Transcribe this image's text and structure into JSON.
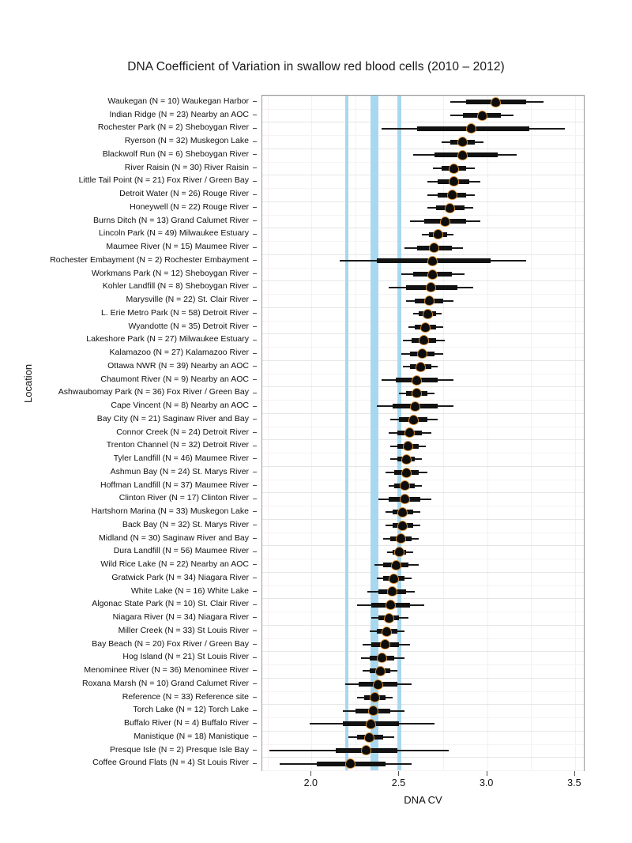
{
  "chart_data": {
    "type": "scatter",
    "title": "DNA Coefficient of Variation in swallow red blood cells (2010 – 2012)",
    "xlabel": "DNA CV",
    "ylabel": "Location",
    "xlim": [
      1.72,
      3.55
    ],
    "xticks": [
      2.0,
      2.5,
      3.0,
      3.5
    ],
    "xticklabels": [
      "2.0",
      "2.5",
      "3.0",
      "3.5"
    ],
    "grid": true,
    "legend": "none",
    "orientation": "horizontal",
    "series_description": "Point estimate with thick inner interval and thin outer interval per location",
    "reference_bands": [
      {
        "name": "ref-band-1",
        "value": 2.2,
        "color": "#a8d8ef"
      },
      {
        "name": "ref-band-2",
        "value": 2.36,
        "color": "#a8d8ef"
      },
      {
        "name": "ref-band-3",
        "value": 2.5,
        "color": "#a8d8ef"
      }
    ],
    "categories": [
      "Waukegan (N = 10) Waukegan Harbor",
      "Indian Ridge (N = 23) Nearby an AOC",
      "Rochester Park (N = 2) Sheboygan River",
      "Ryerson (N = 32) Muskegon Lake",
      "Blackwolf Run (N = 6) Sheboygan River",
      "River Raisin (N = 30) River Raisin",
      "Little Tail Point (N = 21) Fox River / Green Bay",
      "Detroit Water (N = 26) Rouge River",
      "Honeywell (N = 22) Rouge River",
      "Burns Ditch (N = 13) Grand Calumet River",
      "Lincoln Park (N = 49) Milwaukee Estuary",
      "Maumee River (N = 15) Maumee River",
      "Rochester Embayment (N = 2) Rochester Embayment",
      "Workmans Park (N = 12) Sheboygan River",
      "Kohler Landfill (N = 8) Sheboygan River",
      "Marysville (N = 22) St. Clair River",
      "L. Erie Metro Park (N = 58) Detroit River",
      "Wyandotte (N = 35) Detroit River",
      "Lakeshore Park (N = 27) Milwaukee Estuary",
      "Kalamazoo (N = 27) Kalamazoo River",
      "Ottawa NWR (N = 39) Nearby an AOC",
      "Chaumont River (N = 9) Nearby an AOC",
      "Ashwaubomay Park (N = 36) Fox River / Green Bay",
      "Cape Vincent (N = 8) Nearby an AOC",
      "Bay City (N = 21) Saginaw River and Bay",
      "Connor Creek (N = 24) Detroit River",
      "Trenton Channel (N = 32) Detroit River",
      "Tyler Landfill (N = 46) Maumee River",
      "Ashmun Bay (N = 24) St. Marys River",
      "Hoffman Landfill (N = 37) Maumee River",
      "Clinton River (N = 17) Clinton River",
      "Hartshorn Marina (N = 33) Muskegon Lake",
      "Back Bay (N = 32) St. Marys River",
      "Midland (N = 30) Saginaw River and Bay",
      "Dura Landfill (N = 56) Maumee River",
      "Wild Rice Lake (N = 22) Nearby an AOC",
      "Gratwick Park (N = 34) Niagara River",
      "White Lake (N = 16) White Lake",
      "Algonac State Park (N = 10) St. Clair River",
      "Niagara River (N = 34) Niagara River",
      "Miller Creek (N = 33) St Louis River",
      "Bay Beach (N = 20) Fox River / Green Bay",
      "Hog Island (N = 21) St Louis River",
      "Menominee River (N = 36) Menominee River",
      "Roxana Marsh (N = 10) Grand Calumet River",
      "Reference (N = 33) Reference site",
      "Torch Lake (N = 12) Torch Lake",
      "Buffalo River (N = 4) Buffalo River",
      "Manistique (N = 18) Manistique",
      "Presque Isle (N = 2) Presque Isle Bay",
      "Coffee Ground Flats (N = 4) St Louis River"
    ],
    "points": [
      {
        "value": 3.05,
        "inner_low": 2.88,
        "inner_high": 3.22,
        "outer_low": 2.79,
        "outer_high": 3.32
      },
      {
        "value": 2.97,
        "inner_low": 2.86,
        "inner_high": 3.08,
        "outer_low": 2.79,
        "outer_high": 3.15
      },
      {
        "value": 2.91,
        "inner_low": 2.6,
        "inner_high": 3.24,
        "outer_low": 2.4,
        "outer_high": 3.44
      },
      {
        "value": 2.86,
        "inner_low": 2.79,
        "inner_high": 2.93,
        "outer_low": 2.74,
        "outer_high": 2.98
      },
      {
        "value": 2.86,
        "inner_low": 2.7,
        "inner_high": 3.06,
        "outer_low": 2.58,
        "outer_high": 3.17
      },
      {
        "value": 2.81,
        "inner_low": 2.74,
        "inner_high": 2.88,
        "outer_low": 2.69,
        "outer_high": 2.93
      },
      {
        "value": 2.81,
        "inner_low": 2.72,
        "inner_high": 2.9,
        "outer_low": 2.66,
        "outer_high": 2.96
      },
      {
        "value": 2.8,
        "inner_low": 2.72,
        "inner_high": 2.88,
        "outer_low": 2.66,
        "outer_high": 2.93
      },
      {
        "value": 2.79,
        "inner_low": 2.71,
        "inner_high": 2.87,
        "outer_low": 2.66,
        "outer_high": 2.92
      },
      {
        "value": 2.76,
        "inner_low": 2.64,
        "inner_high": 2.88,
        "outer_low": 2.56,
        "outer_high": 2.96
      },
      {
        "value": 2.72,
        "inner_low": 2.67,
        "inner_high": 2.77,
        "outer_low": 2.63,
        "outer_high": 2.81
      },
      {
        "value": 2.7,
        "inner_low": 2.6,
        "inner_high": 2.8,
        "outer_low": 2.53,
        "outer_high": 2.86
      },
      {
        "value": 2.69,
        "inner_low": 2.37,
        "inner_high": 3.02,
        "outer_low": 2.16,
        "outer_high": 3.22
      },
      {
        "value": 2.69,
        "inner_low": 2.58,
        "inner_high": 2.8,
        "outer_low": 2.51,
        "outer_high": 2.87
      },
      {
        "value": 2.68,
        "inner_low": 2.54,
        "inner_high": 2.83,
        "outer_low": 2.44,
        "outer_high": 2.92
      },
      {
        "value": 2.67,
        "inner_low": 2.59,
        "inner_high": 2.75,
        "outer_low": 2.54,
        "outer_high": 2.81
      },
      {
        "value": 2.66,
        "inner_low": 2.61,
        "inner_high": 2.71,
        "outer_low": 2.58,
        "outer_high": 2.74
      },
      {
        "value": 2.65,
        "inner_low": 2.59,
        "inner_high": 2.71,
        "outer_low": 2.55,
        "outer_high": 2.75
      },
      {
        "value": 2.64,
        "inner_low": 2.57,
        "inner_high": 2.71,
        "outer_low": 2.52,
        "outer_high": 2.76
      },
      {
        "value": 2.63,
        "inner_low": 2.56,
        "inner_high": 2.7,
        "outer_low": 2.51,
        "outer_high": 2.75
      },
      {
        "value": 2.62,
        "inner_low": 2.56,
        "inner_high": 2.68,
        "outer_low": 2.52,
        "outer_high": 2.72
      },
      {
        "value": 2.6,
        "inner_low": 2.48,
        "inner_high": 2.72,
        "outer_low": 2.4,
        "outer_high": 2.81
      },
      {
        "value": 2.6,
        "inner_low": 2.54,
        "inner_high": 2.66,
        "outer_low": 2.5,
        "outer_high": 2.7
      },
      {
        "value": 2.59,
        "inner_low": 2.46,
        "inner_high": 2.72,
        "outer_low": 2.37,
        "outer_high": 2.81
      },
      {
        "value": 2.58,
        "inner_low": 2.5,
        "inner_high": 2.66,
        "outer_low": 2.45,
        "outer_high": 2.72
      },
      {
        "value": 2.56,
        "inner_low": 2.49,
        "inner_high": 2.63,
        "outer_low": 2.44,
        "outer_high": 2.68
      },
      {
        "value": 2.55,
        "inner_low": 2.49,
        "inner_high": 2.61,
        "outer_low": 2.45,
        "outer_high": 2.65
      },
      {
        "value": 2.54,
        "inner_low": 2.49,
        "inner_high": 2.59,
        "outer_low": 2.45,
        "outer_high": 2.63
      },
      {
        "value": 2.54,
        "inner_low": 2.47,
        "inner_high": 2.61,
        "outer_low": 2.42,
        "outer_high": 2.66
      },
      {
        "value": 2.53,
        "inner_low": 2.47,
        "inner_high": 2.59,
        "outer_low": 2.44,
        "outer_high": 2.63
      },
      {
        "value": 2.53,
        "inner_low": 2.44,
        "inner_high": 2.62,
        "outer_low": 2.38,
        "outer_high": 2.68
      },
      {
        "value": 2.52,
        "inner_low": 2.46,
        "inner_high": 2.58,
        "outer_low": 2.42,
        "outer_high": 2.62
      },
      {
        "value": 2.52,
        "inner_low": 2.46,
        "inner_high": 2.58,
        "outer_low": 2.42,
        "outer_high": 2.62
      },
      {
        "value": 2.51,
        "inner_low": 2.45,
        "inner_high": 2.57,
        "outer_low": 2.41,
        "outer_high": 2.61
      },
      {
        "value": 2.5,
        "inner_low": 2.46,
        "inner_high": 2.54,
        "outer_low": 2.43,
        "outer_high": 2.58
      },
      {
        "value": 2.48,
        "inner_low": 2.41,
        "inner_high": 2.55,
        "outer_low": 2.36,
        "outer_high": 2.61
      },
      {
        "value": 2.47,
        "inner_low": 2.41,
        "inner_high": 2.53,
        "outer_low": 2.37,
        "outer_high": 2.57
      },
      {
        "value": 2.46,
        "inner_low": 2.38,
        "inner_high": 2.54,
        "outer_low": 2.32,
        "outer_high": 2.59
      },
      {
        "value": 2.45,
        "inner_low": 2.34,
        "inner_high": 2.56,
        "outer_low": 2.26,
        "outer_high": 2.64
      },
      {
        "value": 2.44,
        "inner_low": 2.38,
        "inner_high": 2.5,
        "outer_low": 2.34,
        "outer_high": 2.55
      },
      {
        "value": 2.43,
        "inner_low": 2.37,
        "inner_high": 2.49,
        "outer_low": 2.33,
        "outer_high": 2.53
      },
      {
        "value": 2.42,
        "inner_low": 2.34,
        "inner_high": 2.5,
        "outer_low": 2.29,
        "outer_high": 2.56
      },
      {
        "value": 2.4,
        "inner_low": 2.33,
        "inner_high": 2.47,
        "outer_low": 2.28,
        "outer_high": 2.53
      },
      {
        "value": 2.39,
        "inner_low": 2.33,
        "inner_high": 2.45,
        "outer_low": 2.29,
        "outer_high": 2.49
      },
      {
        "value": 2.38,
        "inner_low": 2.27,
        "inner_high": 2.49,
        "outer_low": 2.19,
        "outer_high": 2.57
      },
      {
        "value": 2.36,
        "inner_low": 2.3,
        "inner_high": 2.42,
        "outer_low": 2.26,
        "outer_high": 2.46
      },
      {
        "value": 2.35,
        "inner_low": 2.25,
        "inner_high": 2.45,
        "outer_low": 2.18,
        "outer_high": 2.53
      },
      {
        "value": 2.34,
        "inner_low": 2.18,
        "inner_high": 2.5,
        "outer_low": 1.99,
        "outer_high": 2.7
      },
      {
        "value": 2.33,
        "inner_low": 2.26,
        "inner_high": 2.41,
        "outer_low": 2.21,
        "outer_high": 2.47
      },
      {
        "value": 2.31,
        "inner_low": 2.14,
        "inner_high": 2.49,
        "outer_low": 1.76,
        "outer_high": 2.78
      },
      {
        "value": 2.22,
        "inner_low": 2.03,
        "inner_high": 2.42,
        "outer_low": 1.82,
        "outer_high": 2.57
      }
    ]
  }
}
